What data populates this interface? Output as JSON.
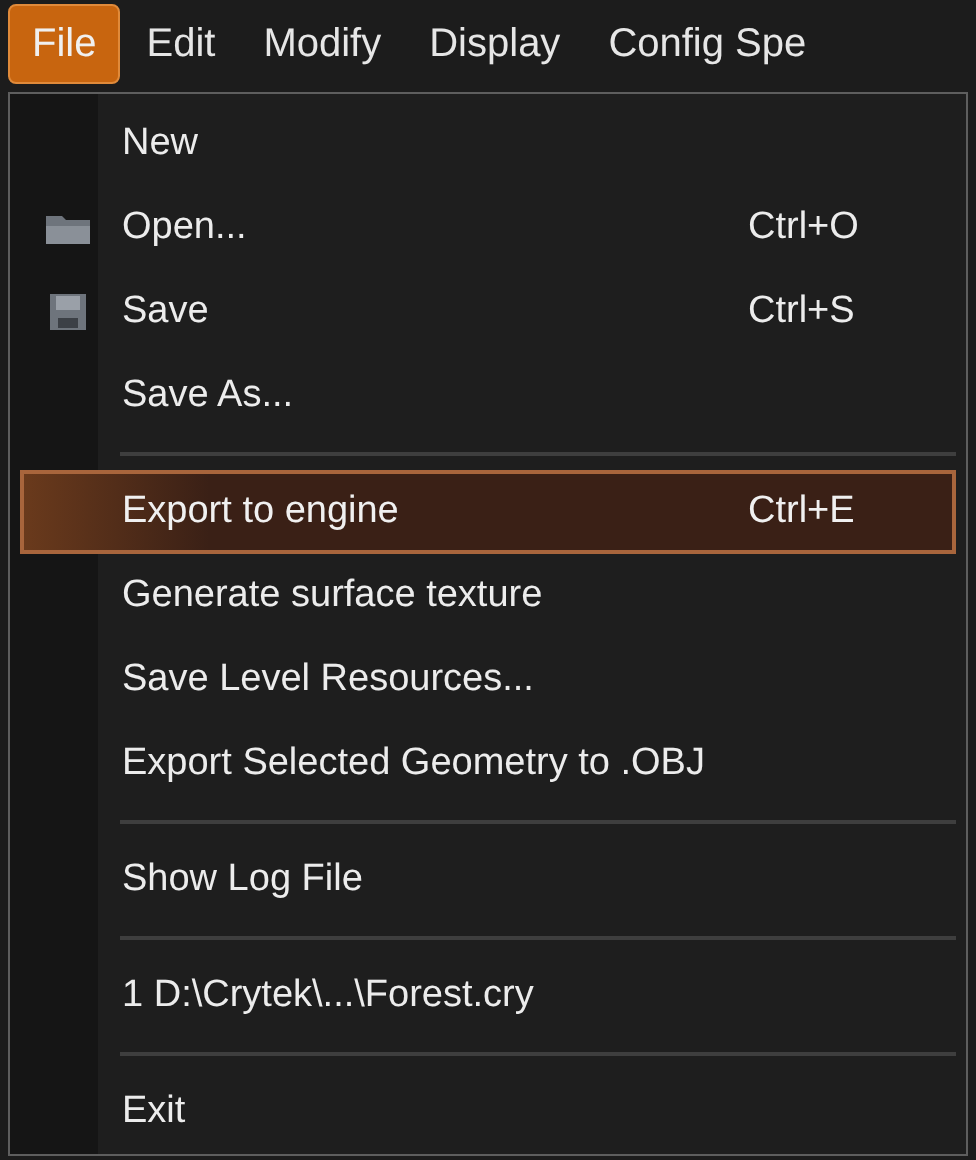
{
  "menubar": [
    {
      "label": "File",
      "selected": true
    },
    {
      "label": "Edit",
      "selected": false
    },
    {
      "label": "Modify",
      "selected": false
    },
    {
      "label": "Display",
      "selected": false
    },
    {
      "label": "Config Spe",
      "selected": false
    }
  ],
  "menu": {
    "items": [
      {
        "kind": "item",
        "label": "New",
        "highlighted": false
      },
      {
        "kind": "open",
        "label": "Open...",
        "shortcut": "Ctrl+O",
        "highlighted": false
      },
      {
        "kind": "save",
        "label": "Save",
        "shortcut": "Ctrl+S",
        "highlighted": false
      },
      {
        "kind": "item",
        "label": "Save As...",
        "highlighted": false
      },
      {
        "kind": "separator"
      },
      {
        "kind": "item",
        "label": "Export to engine",
        "shortcut": "Ctrl+E",
        "highlighted": true
      },
      {
        "kind": "item",
        "label": "Generate surface texture",
        "highlighted": false
      },
      {
        "kind": "item",
        "label": "Save Level Resources...",
        "highlighted": false
      },
      {
        "kind": "item",
        "label": "Export Selected Geometry to .OBJ",
        "highlighted": false
      },
      {
        "kind": "separator"
      },
      {
        "kind": "item",
        "label": "Show Log File",
        "highlighted": false
      },
      {
        "kind": "separator"
      },
      {
        "kind": "item",
        "label": "1 D:\\Crytek\\...\\Forest.cry",
        "highlighted": false
      },
      {
        "kind": "separator"
      },
      {
        "kind": "item",
        "label": "Exit",
        "highlighted": false
      }
    ]
  }
}
